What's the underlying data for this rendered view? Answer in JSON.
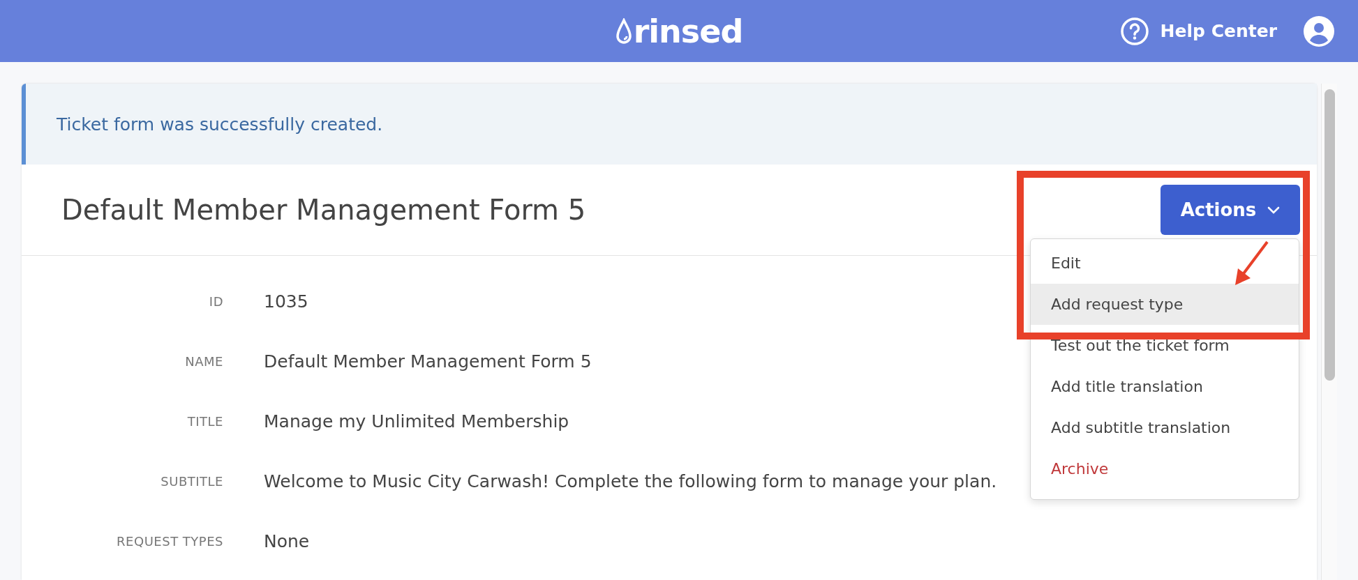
{
  "header": {
    "logo": "rinsed",
    "help_label": "Help Center"
  },
  "alert": {
    "message": "Ticket form was successfully created."
  },
  "page": {
    "title": "Default Member Management Form 5",
    "actions_label": "Actions"
  },
  "fields": [
    {
      "label": "ID",
      "value": "1035"
    },
    {
      "label": "NAME",
      "value": "Default Member Management Form 5"
    },
    {
      "label": "TITLE",
      "value": "Manage my Unlimited Membership"
    },
    {
      "label": "SUBTITLE",
      "value": "Welcome to Music City Carwash! Complete the following form to manage your plan."
    },
    {
      "label": "REQUEST TYPES",
      "value": "None"
    }
  ],
  "actions_menu": {
    "open": true,
    "items": [
      {
        "label": "Edit",
        "highlighted": false,
        "kind": "normal"
      },
      {
        "label": "Add request type",
        "highlighted": true,
        "kind": "normal"
      },
      {
        "label": "Test out the ticket form",
        "highlighted": false,
        "kind": "normal"
      },
      {
        "label": "Add title translation",
        "highlighted": false,
        "kind": "normal"
      },
      {
        "label": "Add subtitle translation",
        "highlighted": false,
        "kind": "normal"
      },
      {
        "label": "Archive",
        "highlighted": false,
        "kind": "danger"
      }
    ]
  }
}
